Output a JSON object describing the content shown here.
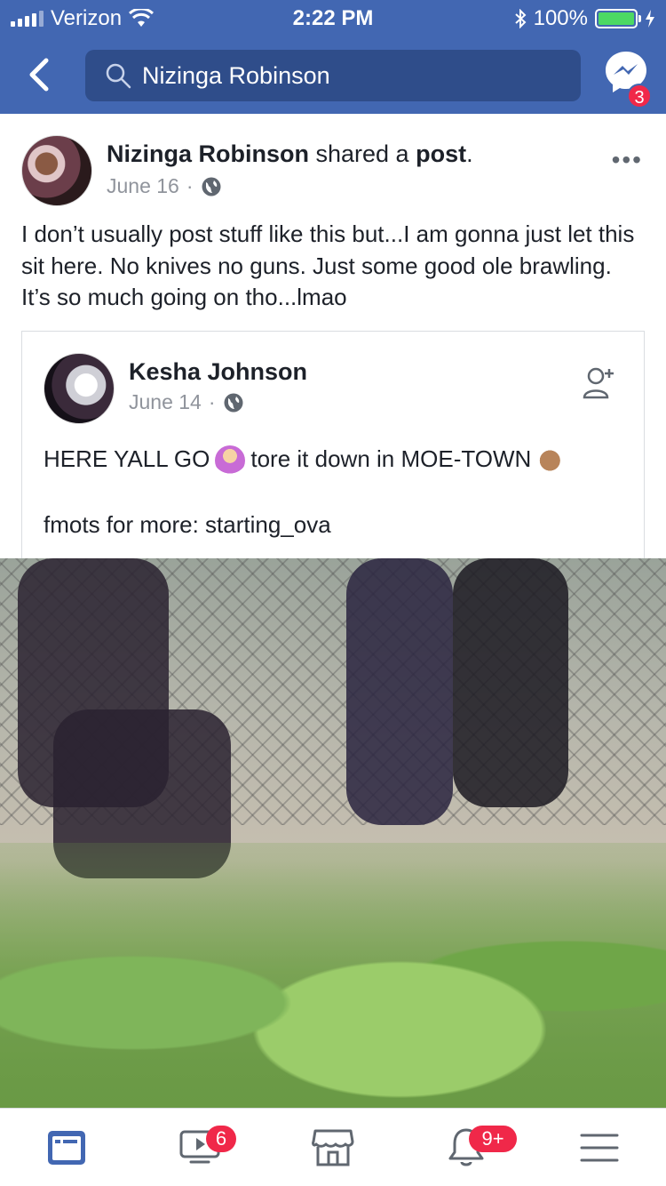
{
  "status_bar": {
    "carrier": "Verizon",
    "time": "2:22 PM",
    "battery": "100%",
    "battery_level": 1.0
  },
  "nav": {
    "search_text": "Nizinga Robinson",
    "messenger_badge": "3"
  },
  "post": {
    "author": "Nizinga Robinson",
    "action_prefix": "shared a",
    "action_object": "post",
    "action_suffix": ".",
    "date": "June 16",
    "separator": "·",
    "text": "I don’t usually post stuff like this but...I am gonna just let this sit here. No knives no guns. Just some good ole brawling. It’s so much going on tho...lmao",
    "more_label": "•••"
  },
  "shared_post": {
    "author": "Kesha Johnson",
    "date": "June 14",
    "separator": "·",
    "text_before_emoji": "HERE YALL GO",
    "text_after_emoji": "tore it down in MOE-TOWN",
    "text_line2": "fmots for more: starting_ova",
    "emoji1": "woman-tipping-hand-emoji",
    "emoji2": "call-me-hand-emoji"
  },
  "tab_bar": {
    "tabs": [
      {
        "name": "news-feed",
        "icon": "news-feed-icon",
        "active": true
      },
      {
        "name": "watch",
        "icon": "video-icon",
        "badge": "6"
      },
      {
        "name": "marketplace",
        "icon": "marketplace-icon"
      },
      {
        "name": "notifications",
        "icon": "bell-icon",
        "badge": "9+"
      },
      {
        "name": "menu",
        "icon": "menu-icon"
      }
    ]
  },
  "colors": {
    "brand": "#4267b2",
    "search_bg": "#2f4d8a",
    "badge": "#f02849",
    "battery_fill": "#4cd964",
    "active_tab": "#4267b2",
    "inactive_tab": "#606770"
  }
}
